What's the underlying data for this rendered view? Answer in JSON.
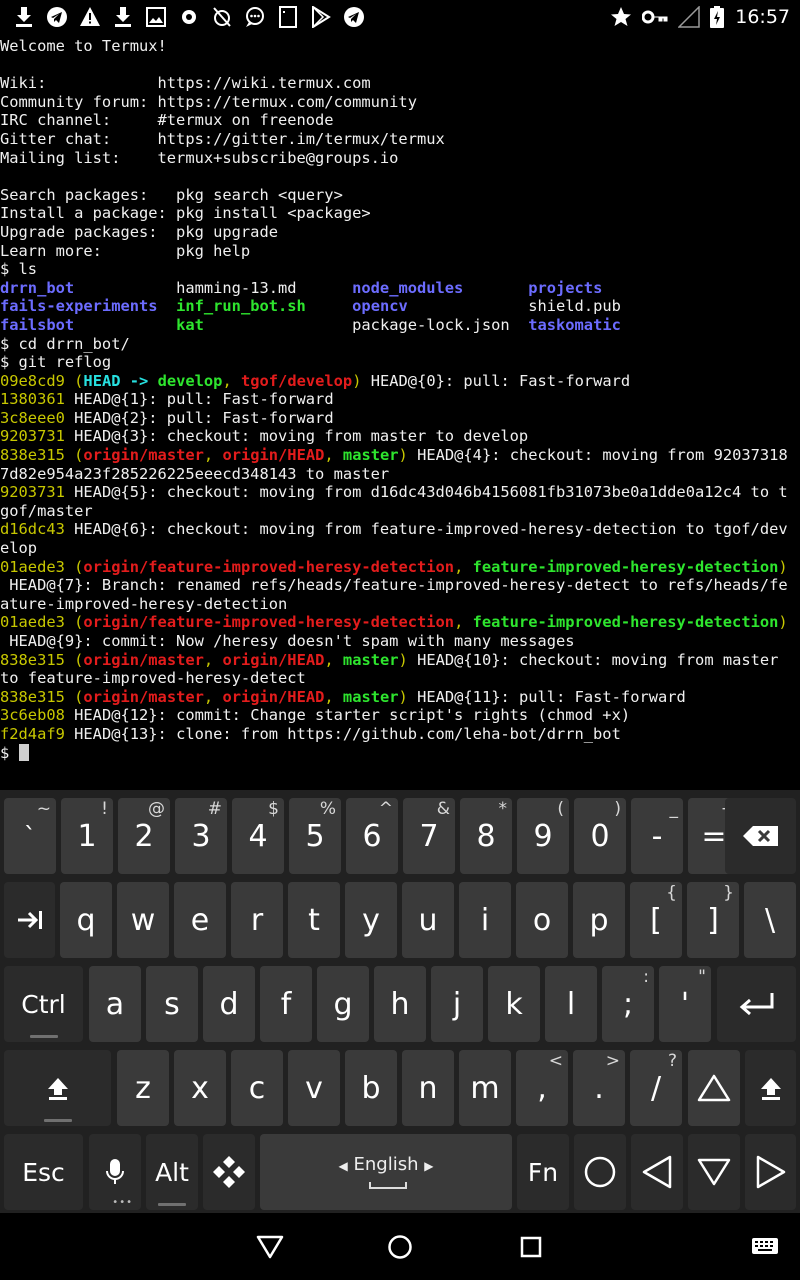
{
  "status_bar": {
    "time": "16:57",
    "notification_icons": [
      "download-icon",
      "telegram-icon",
      "warning-icon",
      "download-icon",
      "image-icon",
      "settings-icon",
      "no-alarm-icon",
      "chat-icon",
      "sim-icon",
      "play-store-icon",
      "telegram-icon"
    ],
    "system_icons": [
      "star-icon",
      "vpn-key-icon",
      "signal-icon",
      "battery-charging-icon"
    ]
  },
  "terminal": {
    "lines": [
      [
        {
          "t": "Welcome to Termux!"
        }
      ],
      [
        {
          "t": ""
        }
      ],
      [
        {
          "t": "Wiki:            https://wiki.termux.com"
        }
      ],
      [
        {
          "t": "Community forum: https://termux.com/community"
        }
      ],
      [
        {
          "t": "IRC channel:     #termux on freenode"
        }
      ],
      [
        {
          "t": "Gitter chat:     https://gitter.im/termux/termux"
        }
      ],
      [
        {
          "t": "Mailing list:    termux+subscribe@groups.io"
        }
      ],
      [
        {
          "t": ""
        }
      ],
      [
        {
          "t": "Search packages:   pkg search <query>"
        }
      ],
      [
        {
          "t": "Install a package: pkg install <package>"
        }
      ],
      [
        {
          "t": "Upgrade packages:  pkg upgrade"
        }
      ],
      [
        {
          "t": "Learn more:        pkg help"
        }
      ],
      [
        {
          "t": "$ ls"
        }
      ],
      [
        {
          "t": "drrn_bot",
          "c": "blue"
        },
        {
          "t": "           hamming-13.md      "
        },
        {
          "t": "node_modules",
          "c": "blue"
        },
        {
          "t": "       "
        },
        {
          "t": "projects",
          "c": "blue"
        }
      ],
      [
        {
          "t": "fails-experiments",
          "c": "blue"
        },
        {
          "t": "  "
        },
        {
          "t": "inf_run_bot.sh",
          "c": "green"
        },
        {
          "t": "     "
        },
        {
          "t": "opencv",
          "c": "blue"
        },
        {
          "t": "             shield.pub"
        }
      ],
      [
        {
          "t": "failsbot",
          "c": "blue"
        },
        {
          "t": "           "
        },
        {
          "t": "kat",
          "c": "green"
        },
        {
          "t": "                package-lock.json  "
        },
        {
          "t": "taskomatic",
          "c": "blue"
        }
      ],
      [
        {
          "t": "$ cd drrn_bot/"
        }
      ],
      [
        {
          "t": "$ git reflog"
        }
      ],
      [
        {
          "t": "09e8cd9",
          "c": "hash"
        },
        {
          "t": " (",
          "c": "hash"
        },
        {
          "t": "HEAD -> ",
          "c": "cyan"
        },
        {
          "t": "develop",
          "c": "green"
        },
        {
          "t": ", ",
          "c": "hash"
        },
        {
          "t": "tgof/develop",
          "c": "red"
        },
        {
          "t": ")",
          "c": "hash"
        },
        {
          "t": " HEAD@{0}: pull: Fast-forward"
        }
      ],
      [
        {
          "t": "1380361",
          "c": "hash"
        },
        {
          "t": " HEAD@{1}: pull: Fast-forward"
        }
      ],
      [
        {
          "t": "3c8eee0",
          "c": "hash"
        },
        {
          "t": " HEAD@{2}: pull: Fast-forward"
        }
      ],
      [
        {
          "t": "9203731",
          "c": "hash"
        },
        {
          "t": " HEAD@{3}: checkout: moving from master to develop"
        }
      ],
      [
        {
          "t": "838e315",
          "c": "hash"
        },
        {
          "t": " (",
          "c": "hash"
        },
        {
          "t": "origin/master",
          "c": "red"
        },
        {
          "t": ", ",
          "c": "hash"
        },
        {
          "t": "origin/HEAD",
          "c": "red"
        },
        {
          "t": ", ",
          "c": "hash"
        },
        {
          "t": "master",
          "c": "green"
        },
        {
          "t": ")",
          "c": "hash"
        },
        {
          "t": " HEAD@{4}: checkout: moving from 92037318"
        }
      ],
      [
        {
          "t": "7d82e954a23f285226225eeecd348143 to master"
        }
      ],
      [
        {
          "t": "9203731",
          "c": "hash"
        },
        {
          "t": " HEAD@{5}: checkout: moving from d16dc43d046b4156081fb31073be0a1dde0a12c4 to t"
        }
      ],
      [
        {
          "t": "gof/master"
        }
      ],
      [
        {
          "t": "d16dc43",
          "c": "hash"
        },
        {
          "t": " HEAD@{6}: checkout: moving from feature-improved-heresy-detection to tgof/dev"
        }
      ],
      [
        {
          "t": "elop"
        }
      ],
      [
        {
          "t": "01aede3",
          "c": "hash"
        },
        {
          "t": " (",
          "c": "hash"
        },
        {
          "t": "origin/feature-improved-heresy-detection",
          "c": "red"
        },
        {
          "t": ", ",
          "c": "hash"
        },
        {
          "t": "feature-improved-heresy-detection",
          "c": "green"
        },
        {
          "t": ")",
          "c": "hash"
        }
      ],
      [
        {
          "t": " HEAD@{7}: Branch: renamed refs/heads/feature-improved-heresy-detect to refs/heads/fe"
        }
      ],
      [
        {
          "t": "ature-improved-heresy-detection"
        }
      ],
      [
        {
          "t": "01aede3",
          "c": "hash"
        },
        {
          "t": " (",
          "c": "hash"
        },
        {
          "t": "origin/feature-improved-heresy-detection",
          "c": "red"
        },
        {
          "t": ", ",
          "c": "hash"
        },
        {
          "t": "feature-improved-heresy-detection",
          "c": "green"
        },
        {
          "t": ")",
          "c": "hash"
        }
      ],
      [
        {
          "t": " HEAD@{9}: commit: Now /heresy doesn't spam with many messages"
        }
      ],
      [
        {
          "t": "838e315",
          "c": "hash"
        },
        {
          "t": " (",
          "c": "hash"
        },
        {
          "t": "origin/master",
          "c": "red"
        },
        {
          "t": ", ",
          "c": "hash"
        },
        {
          "t": "origin/HEAD",
          "c": "red"
        },
        {
          "t": ", ",
          "c": "hash"
        },
        {
          "t": "master",
          "c": "green"
        },
        {
          "t": ")",
          "c": "hash"
        },
        {
          "t": " HEAD@{10}: checkout: moving from master"
        }
      ],
      [
        {
          "t": "to feature-improved-heresy-detect"
        }
      ],
      [
        {
          "t": "838e315",
          "c": "hash"
        },
        {
          "t": " (",
          "c": "hash"
        },
        {
          "t": "origin/master",
          "c": "red"
        },
        {
          "t": ", ",
          "c": "hash"
        },
        {
          "t": "origin/HEAD",
          "c": "red"
        },
        {
          "t": ", ",
          "c": "hash"
        },
        {
          "t": "master",
          "c": "green"
        },
        {
          "t": ")",
          "c": "hash"
        },
        {
          "t": " HEAD@{11}: pull: Fast-forward"
        }
      ],
      [
        {
          "t": "3c6eb08",
          "c": "hash"
        },
        {
          "t": " HEAD@{12}: commit: Change starter script's rights (chmod +x)"
        }
      ],
      [
        {
          "t": "f2d4af9",
          "c": "hash"
        },
        {
          "t": " HEAD@{13}: clone: from https://github.com/leha-bot/drrn_bot"
        }
      ]
    ],
    "prompt": "$ "
  },
  "keyboard": {
    "rows": [
      [
        {
          "m": "`",
          "h": "~"
        },
        {
          "m": "1",
          "h": "!"
        },
        {
          "m": "2",
          "h": "@"
        },
        {
          "m": "3",
          "h": "#"
        },
        {
          "m": "4",
          "h": "$"
        },
        {
          "m": "5",
          "h": "%"
        },
        {
          "m": "6",
          "h": "^"
        },
        {
          "m": "7",
          "h": "&"
        },
        {
          "m": "8",
          "h": "*"
        },
        {
          "m": "9",
          "h": "("
        },
        {
          "m": "0",
          "h": ")"
        },
        {
          "m": "-",
          "h": "_"
        },
        {
          "m": "=",
          "h": "+"
        }
      ],
      [
        {
          "m": "q"
        },
        {
          "m": "w"
        },
        {
          "m": "e"
        },
        {
          "m": "r"
        },
        {
          "m": "t"
        },
        {
          "m": "y"
        },
        {
          "m": "u"
        },
        {
          "m": "i"
        },
        {
          "m": "o"
        },
        {
          "m": "p"
        },
        {
          "m": "[",
          "h": "{"
        },
        {
          "m": "]",
          "h": "}"
        },
        {
          "m": "\\"
        }
      ],
      [
        {
          "m": "a"
        },
        {
          "m": "s"
        },
        {
          "m": "d"
        },
        {
          "m": "f"
        },
        {
          "m": "g"
        },
        {
          "m": "h"
        },
        {
          "m": "j"
        },
        {
          "m": "k"
        },
        {
          "m": "l"
        },
        {
          "m": ";",
          "h": ":"
        },
        {
          "m": "'",
          "h": "\""
        }
      ],
      [
        {
          "m": "z"
        },
        {
          "m": "x"
        },
        {
          "m": "c"
        },
        {
          "m": "v"
        },
        {
          "m": "b"
        },
        {
          "m": "n"
        },
        {
          "m": "m"
        },
        {
          "m": ",",
          "h": "<"
        },
        {
          "m": ".",
          "h": ">"
        },
        {
          "m": "/",
          "h": "?"
        }
      ]
    ],
    "ctrl_label": "Ctrl",
    "esc_label": "Esc",
    "alt_label": "Alt",
    "fn_label": "Fn",
    "language_label": "English"
  },
  "colors": {
    "background": "#000000",
    "keyboard_bg": "#212121",
    "key_bg": "#3a3a3a",
    "hash": "#c8c800",
    "cyan": "#27e0e0",
    "green": "#2ee52e",
    "red": "#e31c1c",
    "blue": "#6c6cff"
  }
}
